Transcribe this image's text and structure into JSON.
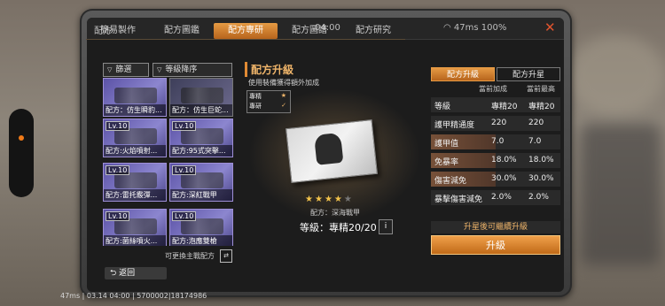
{
  "window": {
    "title": "配方",
    "clock": "04:00",
    "status": "47ms 100%",
    "close": "✕"
  },
  "tabs": [
    "簡易製作",
    "配方圖鑑",
    "配方專研",
    "配方圖譜",
    "配方研究"
  ],
  "active_tab": "配方專研",
  "filters": {
    "filter": "篩選",
    "sort": "等級降序"
  },
  "cards": [
    {
      "lv": "",
      "name": "配方：仿生瞬豹..."
    },
    {
      "lv": "",
      "name": "配方：仿生巨蛇..."
    },
    {
      "lv": "Lv.10",
      "name": "配方:火焰噴射..."
    },
    {
      "lv": "Lv.10",
      "name": "配方:95式突擊..."
    },
    {
      "lv": "Lv.10",
      "name": "配方:雷托霰彈..."
    },
    {
      "lv": "Lv.10",
      "name": "配方:深紅戰甲"
    },
    {
      "lv": "Lv.10",
      "name": "配方:菌絲噴火..."
    },
    {
      "lv": "Lv.10",
      "name": "配方:泡應雙槍"
    }
  ],
  "left_hint": "可更換主戰配方",
  "return_label": "返回",
  "center": {
    "title": "配方升級",
    "subtitle": "使用裝備獲得額外加成",
    "legend": [
      "專精",
      "專研"
    ],
    "stars_on": 4,
    "stars_total": 5,
    "recipe_name": "配方：深海戰甲",
    "level_text": "等級：專精20/20",
    "info": "i"
  },
  "right": {
    "tabs": [
      "配方升級",
      "配方升星"
    ],
    "head_current": "當前加成",
    "head_max": "當前最高",
    "stats": [
      {
        "label": "等級",
        "current": "專精20",
        "max": "專精20",
        "fill": 0
      },
      {
        "label": "護甲精通度",
        "current": "220",
        "max": "220",
        "fill": 0
      },
      {
        "label": "護甲值",
        "current": "7.0",
        "max": "7.0",
        "fill": 0.5
      },
      {
        "label": "免暴率",
        "current": "18.0%",
        "max": "18.0%",
        "fill": 0.5
      },
      {
        "label": "傷害減免",
        "current": "30.0%",
        "max": "30.0%",
        "fill": 0.5
      },
      {
        "label": "暴擊傷害減免",
        "current": "2.0%",
        "max": "2.0%",
        "fill": 0
      }
    ],
    "warning": "升星後可繼續升級",
    "upgrade": "升級"
  },
  "footer": "47ms | 03.14 04:00 | 5700002|18174986"
}
